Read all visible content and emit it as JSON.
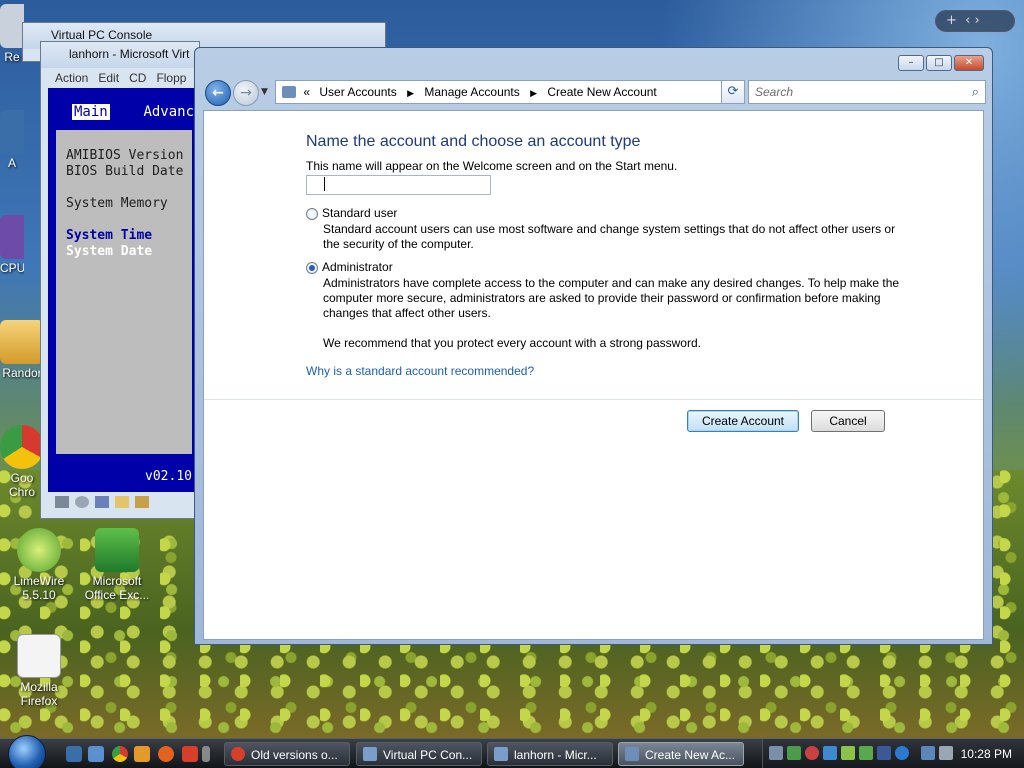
{
  "desktop": {
    "icons": [
      {
        "label": "LimeWire 5.5.10"
      },
      {
        "label": "Microsoft Office Exc..."
      },
      {
        "label": "Mozilla Firefox"
      },
      {
        "label": "Goo Chro"
      },
      {
        "label": "Randor"
      },
      {
        "label": "CPU"
      },
      {
        "label": "Re"
      },
      {
        "label": "A"
      }
    ]
  },
  "background_windows": {
    "vpc_console_title": "Virtual PC Console",
    "vm_window_title": "lanhorn - Microsoft Virt",
    "vm_menu": [
      "Action",
      "Edit",
      "CD",
      "Flopp"
    ],
    "bios": {
      "tabs": [
        "Main",
        "Advance"
      ],
      "lines": [
        "AMIBIOS Version",
        "BIOS Build Date",
        "",
        "System Memory",
        "",
        "System Time",
        "System Date"
      ],
      "version": "v02.10"
    }
  },
  "explorer": {
    "breadcrumb": [
      "User Accounts",
      "Manage Accounts",
      "Create New Account"
    ],
    "breadcrumb_prefix": "«",
    "search_placeholder": "Search",
    "heading": "Name the account and choose an account type",
    "subtext": "This name will appear on the Welcome screen and on the Start menu.",
    "name_value": "",
    "options": {
      "standard": {
        "label": "Standard user",
        "desc": "Standard account users can use most software and change system settings that do not affect other users or the security of the computer.",
        "selected": false
      },
      "admin": {
        "label": "Administrator",
        "desc": "Administrators have complete access to the computer and can make any desired changes. To help make the computer more secure, administrators are asked to provide their password or confirmation before making changes that affect other users.",
        "recommend": "We recommend that you protect every account with a strong password.",
        "selected": true
      }
    },
    "help_link": "Why is a standard account recommended?",
    "buttons": {
      "create": "Create Account",
      "cancel": "Cancel"
    }
  },
  "taskbar": {
    "buttons": [
      {
        "label": "Old versions o...",
        "active": false
      },
      {
        "label": "Virtual PC Con...",
        "active": false
      },
      {
        "label": "lanhorn - Micr...",
        "active": false
      },
      {
        "label": "Create New Ac...",
        "active": true
      }
    ],
    "clock": "10:28 PM"
  }
}
